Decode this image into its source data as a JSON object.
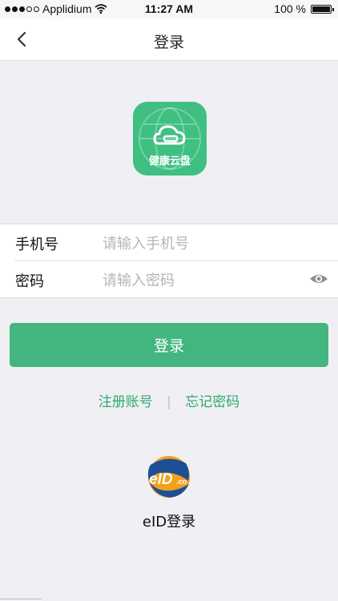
{
  "status_bar": {
    "carrier": "Applidium",
    "time": "11:27 AM",
    "battery": "100 %",
    "battery_level": 1.0,
    "signal_bars_filled": 3,
    "signal_bars_total": 5
  },
  "nav": {
    "title": "登录",
    "back_icon": "chevron-left-icon"
  },
  "logo": {
    "text": "健康云盘",
    "color": "#3fbf82"
  },
  "form": {
    "phone": {
      "label": "手机号",
      "value": "",
      "placeholder": "请输入手机号"
    },
    "password": {
      "label": "密码",
      "value": "",
      "placeholder": "请输入密码",
      "toggle_icon": "eye-icon"
    }
  },
  "login_button": {
    "label": "登录",
    "color": "#43b680"
  },
  "links": {
    "register": "注册账号",
    "separator": "|",
    "forgot": "忘记密码",
    "color": "#2faa6e"
  },
  "eid": {
    "logo_text": "eID",
    "logo_suffix": ".cn",
    "label": "eID登录"
  }
}
